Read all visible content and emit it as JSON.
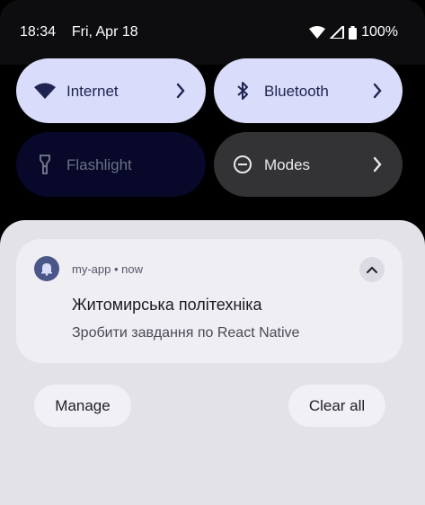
{
  "status": {
    "time": "18:34",
    "date": "Fri, Apr 18",
    "battery_label": "100%",
    "icons": [
      "wifi-icon",
      "signal-icon",
      "battery-icon"
    ]
  },
  "tiles": {
    "internet": {
      "label": "Internet",
      "icon": "wifi-icon",
      "state": "on"
    },
    "bluetooth": {
      "label": "Bluetooth",
      "icon": "bluetooth-icon",
      "state": "on"
    },
    "flashlight": {
      "label": "Flashlight",
      "icon": "flashlight-icon",
      "state": "off"
    },
    "modes": {
      "label": "Modes",
      "icon": "do-not-disturb-icon",
      "state": "neutral"
    }
  },
  "notification": {
    "app": "my-app",
    "time": "now",
    "title": "Житомирська політехніка",
    "body": "Зробити завдання по React Native"
  },
  "actions": {
    "manage": "Manage",
    "clear_all": "Clear all"
  },
  "colors": {
    "tile_active": "#d9dcfa",
    "tile_inactive": "#07082a",
    "tile_neutral": "#333336",
    "sheet": "#e3e2e8",
    "card": "#efeef3",
    "app_icon": "#4b5789"
  }
}
